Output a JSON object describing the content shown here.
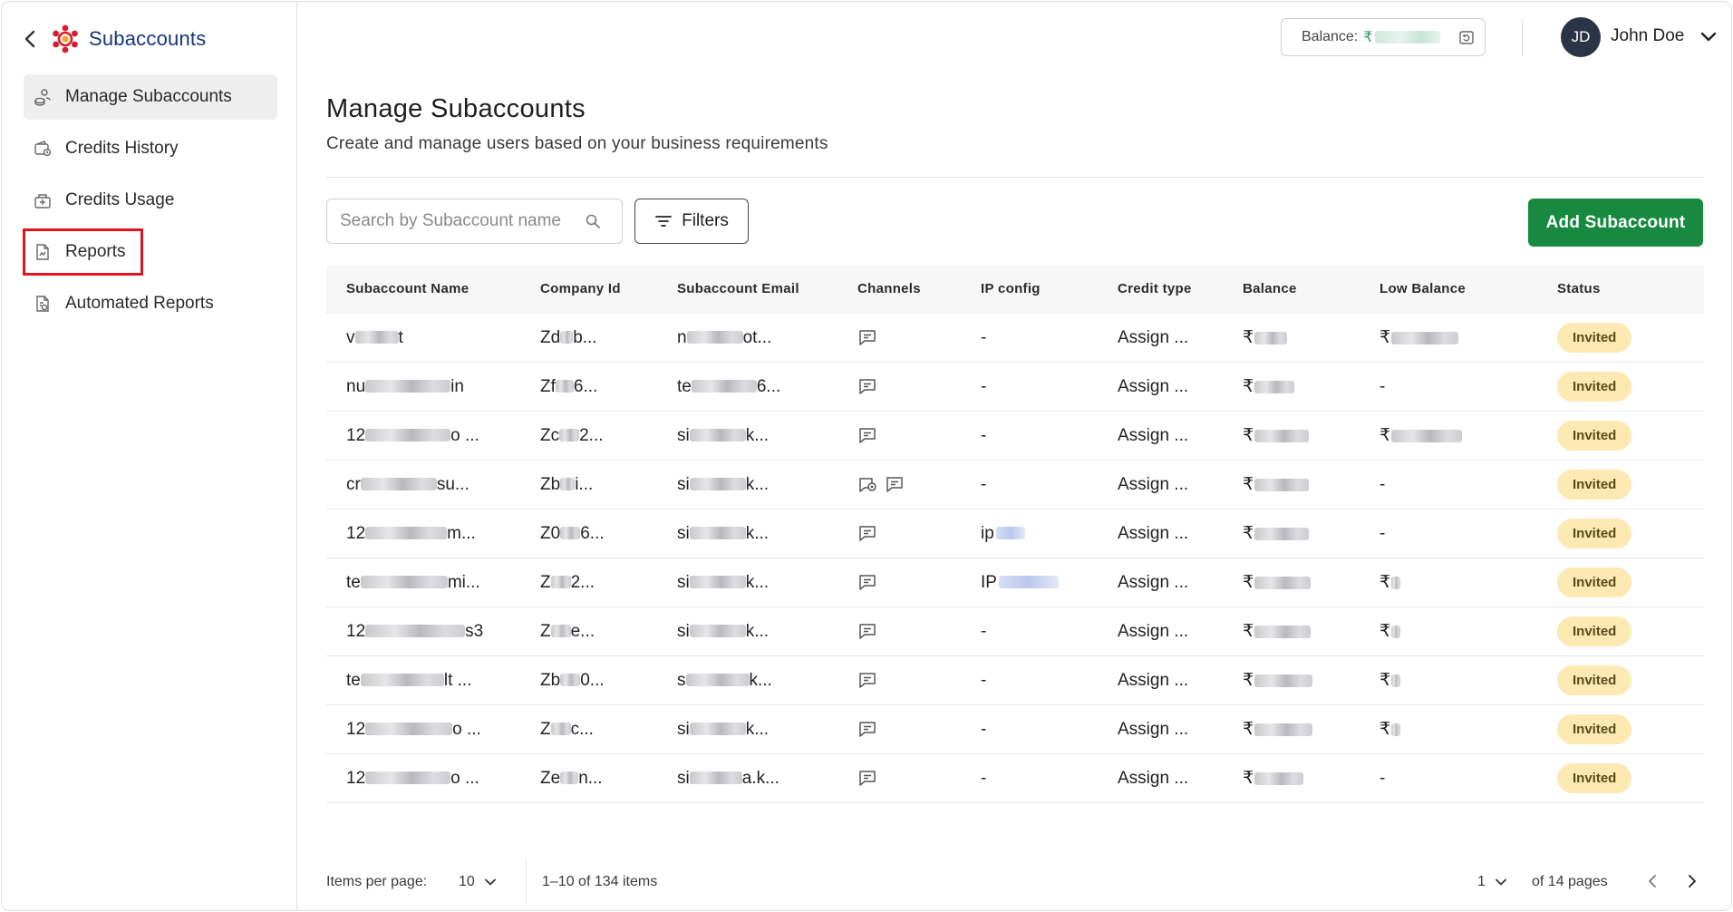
{
  "sidebar": {
    "title": "Subaccounts",
    "items": [
      {
        "label": "Manage Subaccounts",
        "icon": "users-coins-icon"
      },
      {
        "label": "Credits History",
        "icon": "wallet-history-icon"
      },
      {
        "label": "Credits Usage",
        "icon": "usage-box-icon"
      },
      {
        "label": "Reports",
        "icon": "report-document-icon"
      },
      {
        "label": "Automated Reports",
        "icon": "automated-report-icon"
      }
    ]
  },
  "topbar": {
    "balance_label": "Balance:",
    "balance_currency": "₹",
    "user_initials": "JD",
    "user_name": "John Doe"
  },
  "main": {
    "title": "Manage Subaccounts",
    "subtitle": "Create and manage users based on your business requirements",
    "search_placeholder": "Search by Subaccount name",
    "filters_label": "Filters",
    "add_label": "Add Subaccount"
  },
  "table": {
    "headers": [
      "Subaccount Name",
      "Company Id",
      "Subaccount Email",
      "Channels",
      "IP config",
      "Credit type",
      "Balance",
      "Low Balance",
      "Status"
    ],
    "rows": [
      {
        "name_a": "v",
        "name_b": "t",
        "comp_a": "Zd",
        "comp_b": "b...",
        "email_a": "n",
        "email_b": "ot...",
        "channels": 1,
        "ip": "-",
        "credit": "Assign ...",
        "bal": "₹",
        "low": "₹",
        "status": "Invited"
      },
      {
        "name_a": "nu",
        "name_b": "in",
        "comp_a": "Zf",
        "comp_b": "6...",
        "email_a": "te",
        "email_b": "6...",
        "channels": 1,
        "ip": "-",
        "credit": "Assign ...",
        "bal": "₹",
        "low": "-",
        "status": "Invited"
      },
      {
        "name_a": "12",
        "name_b": "o ...",
        "comp_a": "Zc",
        "comp_b": "2...",
        "email_a": "si",
        "email_b": "k...",
        "channels": 1,
        "ip": "-",
        "credit": "Assign ...",
        "bal": "₹",
        "low": "₹",
        "status": "Invited"
      },
      {
        "name_a": "cr",
        "name_b": "su...",
        "comp_a": "Zb",
        "comp_b": "i...",
        "email_a": "si",
        "email_b": "k...",
        "channels": 2,
        "ip": "-",
        "credit": "Assign ...",
        "bal": "₹",
        "low": "-",
        "status": "Invited"
      },
      {
        "name_a": "12",
        "name_b": "m...",
        "comp_a": "Z0",
        "comp_b": "6...",
        "email_a": "si",
        "email_b": "k...",
        "channels": 1,
        "ip": "ip",
        "credit": "Assign ...",
        "bal": "₹",
        "low": "-",
        "status": "Invited"
      },
      {
        "name_a": "te",
        "name_b": "mi...",
        "comp_a": "Z",
        "comp_b": "2...",
        "email_a": "si",
        "email_b": "k...",
        "channels": 1,
        "ip": "IP",
        "credit": "Assign ...",
        "bal": "₹",
        "low": "₹",
        "status": "Invited"
      },
      {
        "name_a": "12",
        "name_b": "s3",
        "comp_a": "Z",
        "comp_b": "e...",
        "email_a": "si",
        "email_b": "k...",
        "channels": 1,
        "ip": "-",
        "credit": "Assign ...",
        "bal": "₹",
        "low": "₹",
        "status": "Invited"
      },
      {
        "name_a": "te",
        "name_b": "lt ...",
        "comp_a": "Zb",
        "comp_b": "0...",
        "email_a": "s",
        "email_b": "k...",
        "channels": 1,
        "ip": "-",
        "credit": "Assign ...",
        "bal": "₹",
        "low": "₹",
        "status": "Invited"
      },
      {
        "name_a": "12",
        "name_b": "o ...",
        "comp_a": "Z",
        "comp_b": "c...",
        "email_a": "si",
        "email_b": "k...",
        "channels": 1,
        "ip": "-",
        "credit": "Assign ...",
        "bal": "₹",
        "low": "₹",
        "status": "Invited"
      },
      {
        "name_a": "12",
        "name_b": "o ...",
        "comp_a": "Ze",
        "comp_b": "n...",
        "email_a": "si",
        "email_b": "a.k...",
        "channels": 1,
        "ip": "-",
        "credit": "Assign ...",
        "bal": "₹",
        "low": "-",
        "status": "Invited"
      }
    ]
  },
  "footer": {
    "items_per_page_label": "Items per page:",
    "items_per_page_value": "10",
    "range_text": "1–10 of 134 items",
    "page_value": "1",
    "of_pages_text": "of 14 pages"
  },
  "colors": {
    "brand": "#15357a",
    "accent_green": "#178a3f",
    "badge_bg": "#fde9b2",
    "highlight": "#e0141e"
  }
}
